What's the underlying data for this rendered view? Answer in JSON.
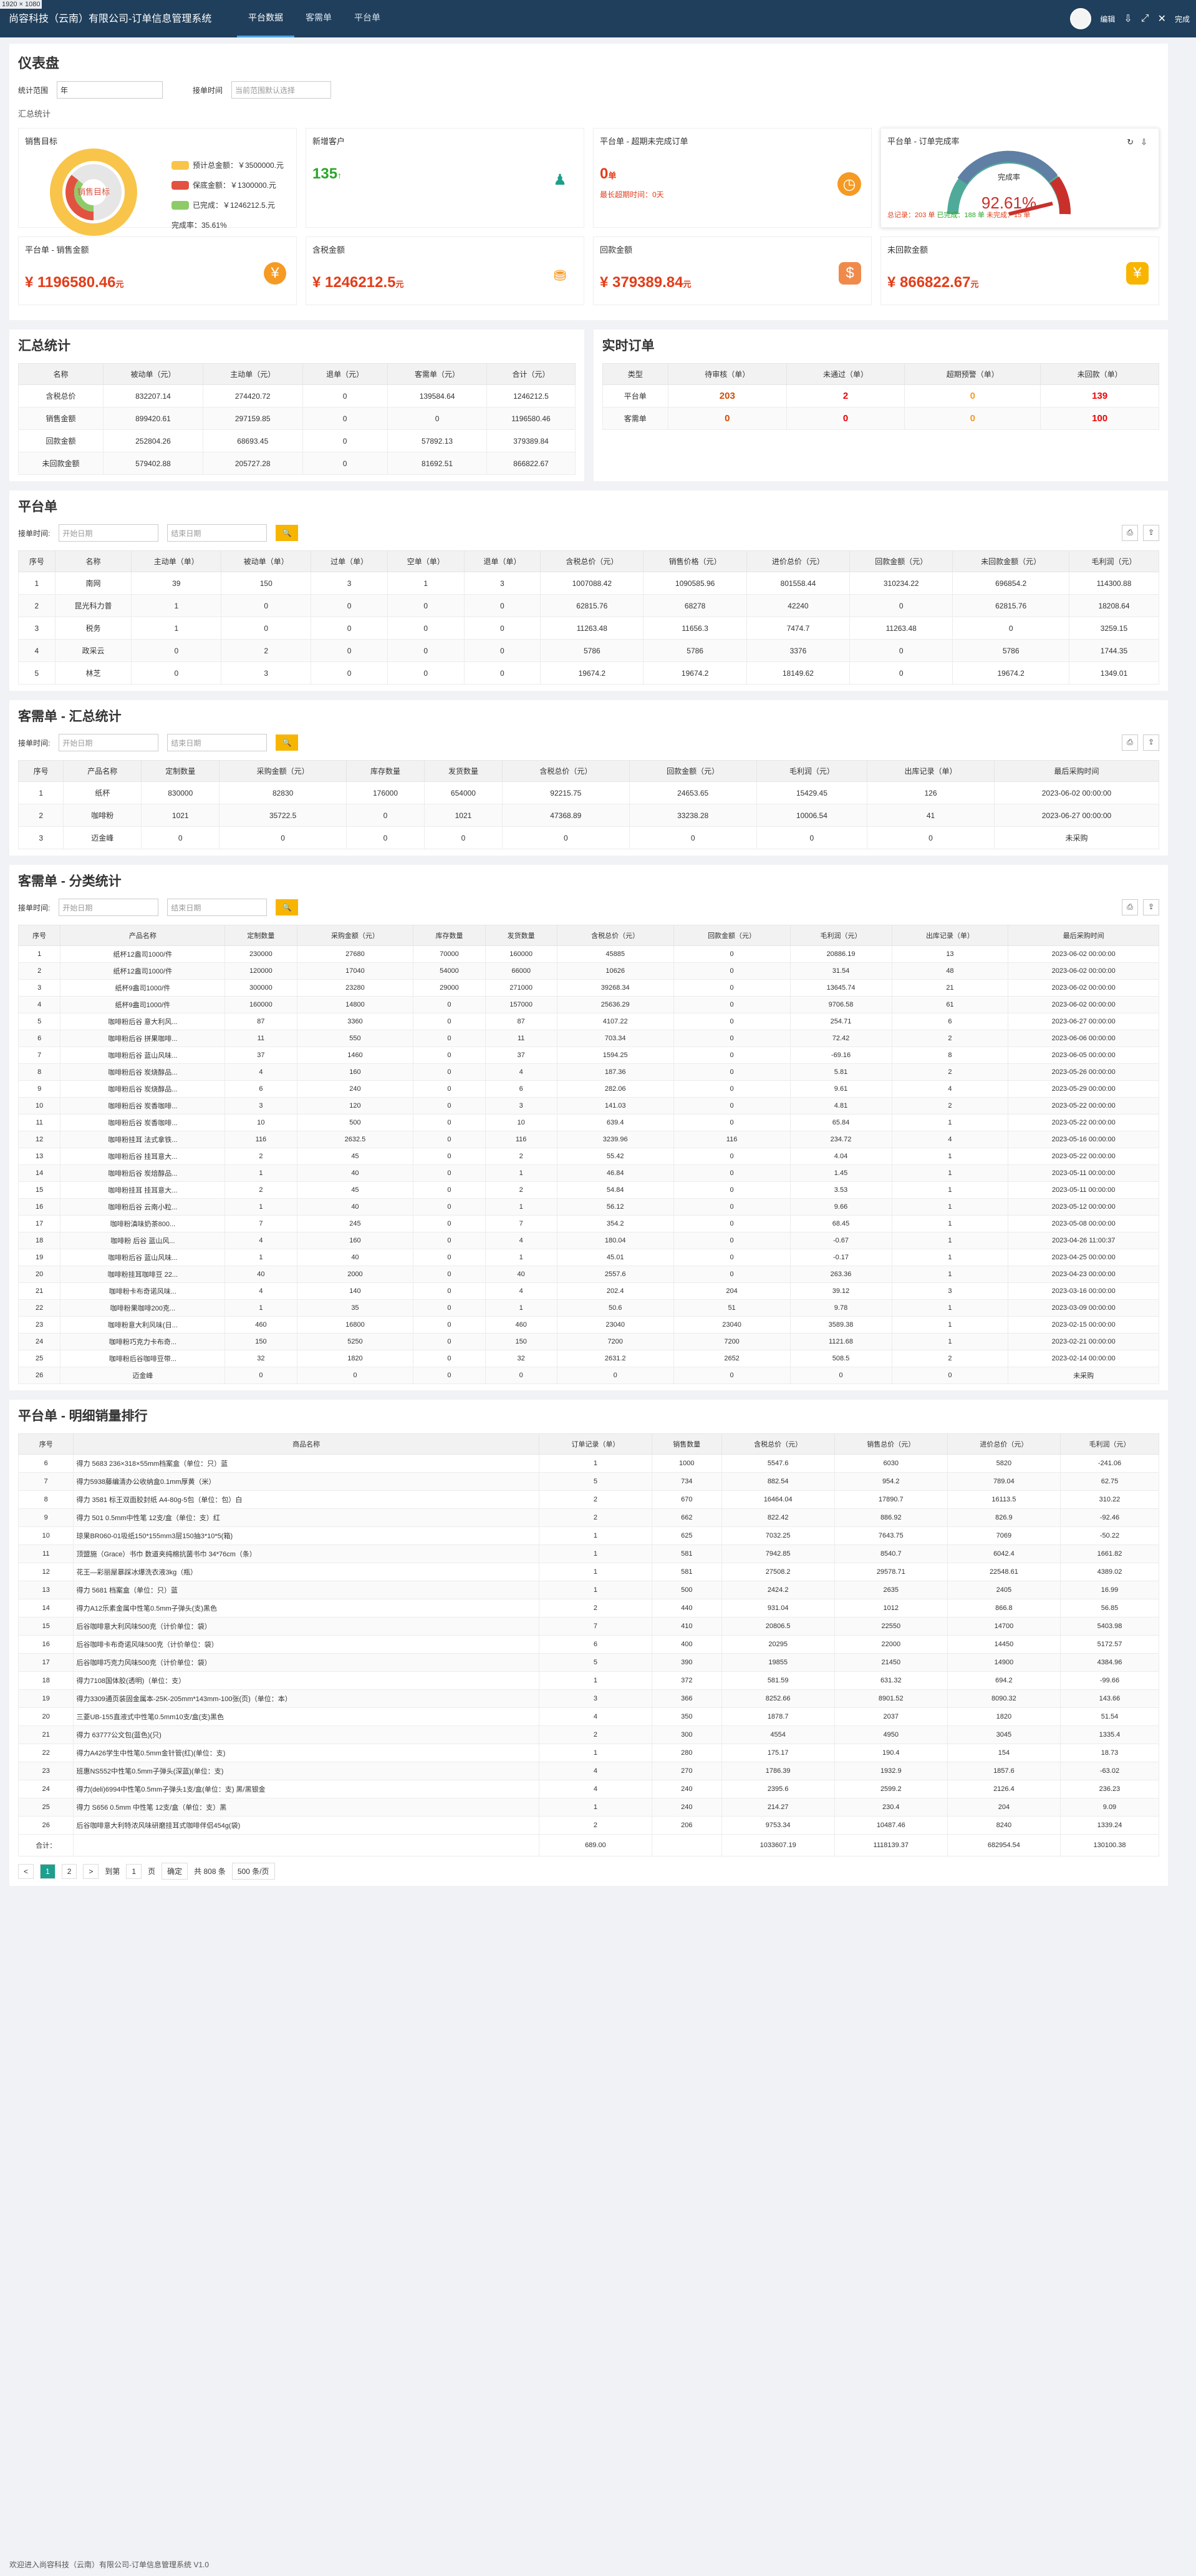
{
  "topbar": {
    "resolution": "1920 × 1080",
    "brand": "尚容科技（云南）有限公司-订单信息管理系统",
    "tabs": [
      "平台数据",
      "客需单",
      "平台单"
    ],
    "user": "编辑",
    "close": "完成"
  },
  "dash": {
    "title": "仪表盘",
    "range_label": "统计范围",
    "range_value": "年",
    "time_label": "接单时间",
    "time_placeholder": "当前范围默认选择",
    "section": "汇总统计"
  },
  "sales_target": {
    "title": "销售目标",
    "center": "销售目标",
    "legend": [
      "预计总金额：￥3500000.元",
      "保底金额：￥1300000.元",
      "已完成：￥1246212.5.元"
    ],
    "rate": "完成率：35.61%"
  },
  "new_customers": {
    "title": "新增客户",
    "value": "135"
  },
  "overdue": {
    "title": "平台单 - 超期未完成订单",
    "value": "0",
    "unit": "单",
    "note": "最长超期时间：0天"
  },
  "completion": {
    "title": "平台单 - 订单完成率",
    "label": "完成率",
    "value": "92.61%",
    "value_number": 92.61,
    "total": "总记录：203 单",
    "done": "已完成：188 单",
    "undone": "未完成：15 单"
  },
  "money_cards": [
    {
      "title": "平台单 - 销售金额",
      "value": "¥ 1196580.46",
      "unit": "元"
    },
    {
      "title": "含税金额",
      "value": "¥ 1246212.5",
      "unit": "元"
    },
    {
      "title": "回款金额",
      "value": "¥ 379389.84",
      "unit": "元"
    },
    {
      "title": "未回款金额",
      "value": "¥ 866822.67",
      "unit": "元"
    }
  ],
  "summary": {
    "title": "汇总统计",
    "headers": [
      "名称",
      "被动单（元）",
      "主动单（元）",
      "退单（元）",
      "客需单（元）",
      "合计（元）"
    ],
    "rows": [
      [
        "含税总价",
        "832207.14",
        "274420.72",
        "0",
        "139584.64",
        "1246212.5"
      ],
      [
        "销售金额",
        "899420.61",
        "297159.85",
        "0",
        "0",
        "1196580.46"
      ],
      [
        "回款金额",
        "252804.26",
        "68693.45",
        "0",
        "57892.13",
        "379389.84"
      ],
      [
        "未回款金额",
        "579402.88",
        "205727.28",
        "0",
        "81692.51",
        "866822.67"
      ]
    ]
  },
  "realtime": {
    "title": "实时订单",
    "headers": [
      "类型",
      "待审核（单）",
      "未通过（单）",
      "超期预警（单）",
      "未回款（单）"
    ],
    "rows": [
      [
        "平台单",
        "203",
        "2",
        "0",
        "139"
      ],
      [
        "客需单",
        "0",
        "0",
        "0",
        "100"
      ]
    ]
  },
  "platform": {
    "title": "平台单",
    "date_label": "接单时间:",
    "start": "开始日期",
    "end": "结束日期",
    "headers": [
      "序号",
      "名称",
      "主动单（单）",
      "被动单（单）",
      "过单（单）",
      "空单（单）",
      "退单（单）",
      "含税总价（元）",
      "销售价格（元）",
      "进价总价（元）",
      "回款金额（元）",
      "未回款金额（元）",
      "毛利润（元）"
    ],
    "rows": [
      [
        "1",
        "南网",
        "39",
        "150",
        "3",
        "1",
        "3",
        "1007088.42",
        "1090585.96",
        "801558.44",
        "310234.22",
        "696854.2",
        "114300.88"
      ],
      [
        "2",
        "昆光科力普",
        "1",
        "0",
        "0",
        "0",
        "0",
        "62815.76",
        "68278",
        "42240",
        "0",
        "62815.76",
        "18208.64"
      ],
      [
        "3",
        "税务",
        "1",
        "0",
        "0",
        "0",
        "0",
        "11263.48",
        "11656.3",
        "7474.7",
        "11263.48",
        "0",
        "3259.15"
      ],
      [
        "4",
        "政采云",
        "0",
        "2",
        "0",
        "0",
        "0",
        "5786",
        "5786",
        "3376",
        "0",
        "5786",
        "1744.35"
      ],
      [
        "5",
        "林芝",
        "0",
        "3",
        "0",
        "0",
        "0",
        "19674.2",
        "19674.2",
        "18149.62",
        "0",
        "19674.2",
        "1349.01"
      ]
    ]
  },
  "kx_summary": {
    "title": "客需单 - 汇总统计",
    "headers": [
      "序号",
      "产品名称",
      "定制数量",
      "采购金额（元）",
      "库存数量",
      "发货数量",
      "含税总价（元）",
      "回款金额（元）",
      "毛利润（元）",
      "出库记录（单）",
      "最后采购时间"
    ],
    "rows": [
      [
        "1",
        "纸杯",
        "830000",
        "82830",
        "176000",
        "654000",
        "92215.75",
        "24653.65",
        "15429.45",
        "126",
        "2023-06-02 00:00:00"
      ],
      [
        "2",
        "咖啡粉",
        "1021",
        "35722.5",
        "0",
        "1021",
        "47368.89",
        "33238.28",
        "10006.54",
        "41",
        "2023-06-27 00:00:00"
      ],
      [
        "3",
        "迈金峰",
        "0",
        "0",
        "0",
        "0",
        "0",
        "0",
        "0",
        "0",
        "未采购"
      ]
    ]
  },
  "kx_class": {
    "title": "客需单 - 分类统计",
    "headers": [
      "序号",
      "产品名称",
      "定制数量",
      "采购金额（元）",
      "库存数量",
      "发货数量",
      "含税总价（元）",
      "回款金额（元）",
      "毛利润（元）",
      "出库记录（单）",
      "最后采购时间"
    ],
    "rows": [
      [
        "1",
        "纸杯12盎司1000/件",
        "230000",
        "27680",
        "70000",
        "160000",
        "45885",
        "0",
        "20886.19",
        "13",
        "2023-06-02 00:00:00"
      ],
      [
        "2",
        "纸杯12盎司1000/件",
        "120000",
        "17040",
        "54000",
        "66000",
        "10626",
        "0",
        "31.54",
        "48",
        "2023-06-02 00:00:00"
      ],
      [
        "3",
        "纸杯9盎司1000/件",
        "300000",
        "23280",
        "29000",
        "271000",
        "39268.34",
        "0",
        "13645.74",
        "21",
        "2023-06-02 00:00:00"
      ],
      [
        "4",
        "纸杯9盎司1000/件",
        "160000",
        "14800",
        "0",
        "157000",
        "25636.29",
        "0",
        "9706.58",
        "61",
        "2023-06-02 00:00:00"
      ],
      [
        "5",
        "咖啡粉后谷 意大利风...",
        "87",
        "3360",
        "0",
        "87",
        "4107.22",
        "0",
        "254.71",
        "6",
        "2023-06-27 00:00:00"
      ],
      [
        "6",
        "咖啡粉后谷 拼果咖啡...",
        "11",
        "550",
        "0",
        "11",
        "703.34",
        "0",
        "72.42",
        "2",
        "2023-06-06 00:00:00"
      ],
      [
        "7",
        "咖啡粉后谷 蓝山风味...",
        "37",
        "1460",
        "0",
        "37",
        "1594.25",
        "0",
        "-69.16",
        "8",
        "2023-06-05 00:00:00"
      ],
      [
        "8",
        "咖啡粉后谷 炭烧醇品...",
        "4",
        "160",
        "0",
        "4",
        "187.36",
        "0",
        "5.81",
        "2",
        "2023-05-26 00:00:00"
      ],
      [
        "9",
        "咖啡粉后谷 炭烧醇品...",
        "6",
        "240",
        "0",
        "6",
        "282.06",
        "0",
        "9.61",
        "4",
        "2023-05-29 00:00:00"
      ],
      [
        "10",
        "咖啡粉后谷 炭香咖啡...",
        "3",
        "120",
        "0",
        "3",
        "141.03",
        "0",
        "4.81",
        "2",
        "2023-05-22 00:00:00"
      ],
      [
        "11",
        "咖啡粉后谷 炭香咖啡...",
        "10",
        "500",
        "0",
        "10",
        "639.4",
        "0",
        "65.84",
        "1",
        "2023-05-22 00:00:00"
      ],
      [
        "12",
        "咖啡粉挂耳 法式拿铁...",
        "116",
        "2632.5",
        "0",
        "116",
        "3239.96",
        "116",
        "234.72",
        "4",
        "2023-05-16 00:00:00"
      ],
      [
        "13",
        "咖啡粉后谷 挂耳意大...",
        "2",
        "45",
        "0",
        "2",
        "55.42",
        "0",
        "4.04",
        "1",
        "2023-05-22 00:00:00"
      ],
      [
        "14",
        "咖啡粉后谷 炭焙醇品...",
        "1",
        "40",
        "0",
        "1",
        "46.84",
        "0",
        "1.45",
        "1",
        "2023-05-11 00:00:00"
      ],
      [
        "15",
        "咖啡粉挂耳 挂耳意大...",
        "2",
        "45",
        "0",
        "2",
        "54.84",
        "0",
        "3.53",
        "1",
        "2023-05-11 00:00:00"
      ],
      [
        "16",
        "咖啡粉后谷 云南小粒...",
        "1",
        "40",
        "0",
        "1",
        "56.12",
        "0",
        "9.66",
        "1",
        "2023-05-12 00:00:00"
      ],
      [
        "17",
        "咖啡粉滇味奶茶800...",
        "7",
        "245",
        "0",
        "7",
        "354.2",
        "0",
        "68.45",
        "1",
        "2023-05-08 00:00:00"
      ],
      [
        "18",
        "咖啡粉 后谷 蓝山风...",
        "4",
        "160",
        "0",
        "4",
        "180.04",
        "0",
        "-0.67",
        "1",
        "2023-04-26 11:00:37"
      ],
      [
        "19",
        "咖啡粉后谷 蓝山风味...",
        "1",
        "40",
        "0",
        "1",
        "45.01",
        "0",
        "-0.17",
        "1",
        "2023-04-25 00:00:00"
      ],
      [
        "20",
        "咖啡粉挂耳咖啡豆 22...",
        "40",
        "2000",
        "0",
        "40",
        "2557.6",
        "0",
        "263.36",
        "1",
        "2023-04-23 00:00:00"
      ],
      [
        "21",
        "咖啡粉卡布奇诺风味...",
        "4",
        "140",
        "0",
        "4",
        "202.4",
        "204",
        "39.12",
        "3",
        "2023-03-16 00:00:00"
      ],
      [
        "22",
        "咖啡粉果咖啡200克...",
        "1",
        "35",
        "0",
        "1",
        "50.6",
        "51",
        "9.78",
        "1",
        "2023-03-09 00:00:00"
      ],
      [
        "23",
        "咖啡粉意大利风味(日...",
        "460",
        "16800",
        "0",
        "460",
        "23040",
        "23040",
        "3589.38",
        "1",
        "2023-02-15 00:00:00"
      ],
      [
        "24",
        "咖啡粉巧克力卡布奇...",
        "150",
        "5250",
        "0",
        "150",
        "7200",
        "7200",
        "1121.68",
        "1",
        "2023-02-21 00:00:00"
      ],
      [
        "25",
        "咖啡粉后谷咖啡豆带...",
        "32",
        "1820",
        "0",
        "32",
        "2631.2",
        "2652",
        "508.5",
        "2",
        "2023-02-14 00:00:00"
      ],
      [
        "26",
        "迈金峰",
        "0",
        "0",
        "0",
        "0",
        "0",
        "0",
        "0",
        "0",
        "未采购"
      ]
    ]
  },
  "ranking": {
    "title": "平台单 - 明细销量排行",
    "headers": [
      "序号",
      "商品名称",
      "订单记录（单）",
      "销售数量",
      "含税总价（元）",
      "销售总价（元）",
      "进价总价（元）",
      "毛利润（元）"
    ],
    "rows": [
      [
        "6",
        "得力 5683 236×318×55mm档案盒（单位：只）蓝",
        "1",
        "1000",
        "5547.6",
        "6030",
        "5820",
        "-241.06"
      ],
      [
        "7",
        "得力5938藤编清办公收纳盒0.1mm厚黄（米）",
        "5",
        "734",
        "882.54",
        "954.2",
        "789.04",
        "62.75"
      ],
      [
        "8",
        "得力 3581 标王双面胶封纸 A4-80g-5包（单位：包）白",
        "2",
        "670",
        "16464.04",
        "17890.7",
        "16113.5",
        "310.22"
      ],
      [
        "9",
        "得力 501 0.5mm中性笔 12支/盒（单位：支）红",
        "2",
        "662",
        "822.42",
        "886.92",
        "826.9",
        "-92.46"
      ],
      [
        "10",
        "琼果BR060-01吸纸150*155mm3层150抽3*10*5(箱)",
        "1",
        "625",
        "7032.25",
        "7643.75",
        "7069",
        "-50.22"
      ],
      [
        "11",
        "顶盟施（Grace）书巾 数道夹纯棉抗菌书巾 34*76cm（条）",
        "1",
        "581",
        "7942.85",
        "8540.7",
        "6042.4",
        "1661.82"
      ],
      [
        "12",
        "花王—彩丽屋暴踩冰爆洗衣液3kg（瓶）",
        "1",
        "581",
        "27508.2",
        "29578.71",
        "22548.61",
        "4389.02"
      ],
      [
        "13",
        "得力 5681 档案盒（单位：只）蓝",
        "1",
        "500",
        "2424.2",
        "2635",
        "2405",
        "16.99"
      ],
      [
        "14",
        "得力A12乐素金属中性笔0.5mm子弹头(支)黑色",
        "2",
        "440",
        "931.04",
        "1012",
        "866.8",
        "56.85"
      ],
      [
        "15",
        "后谷咖啡意大利风味500克（计价单位：袋）",
        "7",
        "410",
        "20806.5",
        "22550",
        "14700",
        "5403.98"
      ],
      [
        "16",
        "后谷咖啡卡布奇诺风味500克（计价单位：袋）",
        "6",
        "400",
        "20295",
        "22000",
        "14450",
        "5172.57"
      ],
      [
        "17",
        "后谷咖啡巧克力风味500克（计价单位：袋）",
        "5",
        "390",
        "19855",
        "21450",
        "14900",
        "4384.96"
      ],
      [
        "18",
        "得力7108国体胶(透明)（单位：支）",
        "1",
        "372",
        "581.59",
        "631.32",
        "694.2",
        "-99.66"
      ],
      [
        "19",
        "得力3309通页装固金属本-25K-205mm*143mm-100张(页)（单位：本）",
        "3",
        "366",
        "8252.66",
        "8901.52",
        "8090.32",
        "143.66"
      ],
      [
        "20",
        "三菱UB-155直液式中性笔0.5mm10支/盒(支)黑色",
        "4",
        "350",
        "1878.7",
        "2037",
        "1820",
        "51.54"
      ],
      [
        "21",
        "得力 63777公文包(蓝色)(只)",
        "2",
        "300",
        "4554",
        "4950",
        "3045",
        "1335.4"
      ],
      [
        "22",
        "得力A426学生中性笔0.5mm金针管(红)(单位：支)",
        "1",
        "280",
        "175.17",
        "190.4",
        "154",
        "18.73"
      ],
      [
        "23",
        "班惠NS552中性笔0.5mm子弹头(深蓝)(单位：支)",
        "4",
        "270",
        "1786.39",
        "1932.9",
        "1857.6",
        "-63.02"
      ],
      [
        "24",
        "得力(deli)6994中性笔0.5mm子弹头1支/盒(单位：支) 黑/黑银金",
        "4",
        "240",
        "2395.6",
        "2599.2",
        "2126.4",
        "236.23"
      ],
      [
        "25",
        "得力 S656 0.5mm 中性笔 12支/盒（单位：支）黑",
        "1",
        "240",
        "214.27",
        "230.4",
        "204",
        "9.09"
      ],
      [
        "26",
        "后谷咖啡意大利特浓风味研磨挂耳式咖啡伴侣454g(袋)",
        "2",
        "206",
        "9753.34",
        "10487.46",
        "8240",
        "1339.24"
      ]
    ],
    "total": {
      "label": "合计：",
      "orders": "689.00",
      "sale": "1033607.19",
      "revenue": "1118139.37",
      "cost": "682954.54",
      "profit": "130100.38"
    },
    "pager": {
      "prev": "<",
      "pages": [
        "1",
        "2"
      ],
      "next": ">",
      "goto": "到第",
      "page": "1",
      "unit": "页",
      "ok": "确定",
      "count": "共 808 条",
      "size": "500 条/页"
    }
  },
  "footer": "欢迎进入尚容科技（云南）有限公司-订单信息管理系统 V1.0"
}
